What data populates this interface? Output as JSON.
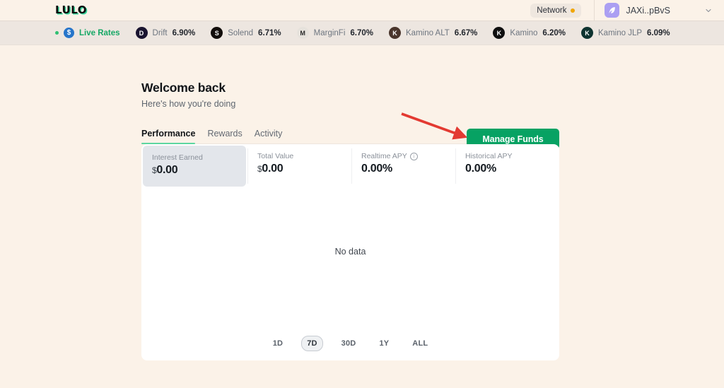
{
  "header": {
    "logo": "LULO",
    "network_label": "Network",
    "network_dot_color": "#F0A500",
    "wallet_name": "JAXi..pBvS"
  },
  "ticker": {
    "live_label": "Live Rates",
    "items": [
      {
        "name": "Drift",
        "rate": "6.90%",
        "icon_color": "#1A1430",
        "icon_char": "D"
      },
      {
        "name": "Solend",
        "rate": "6.71%",
        "icon_color": "#120D0A",
        "icon_char": "S"
      },
      {
        "name": "MarginFi",
        "rate": "6.70%",
        "icon_color": "#E6E2DC",
        "icon_char": "M"
      },
      {
        "name": "Kamino ALT",
        "rate": "6.67%",
        "icon_color": "#4A352C",
        "icon_char": "K"
      },
      {
        "name": "Kamino",
        "rate": "6.20%",
        "icon_color": "#0F0F0F",
        "icon_char": "K"
      },
      {
        "name": "Kamino JLP",
        "rate": "6.09%",
        "icon_color": "#0E3330",
        "icon_char": "K"
      }
    ]
  },
  "welcome": {
    "title": "Welcome back",
    "subtitle": "Here's how you're doing"
  },
  "actions": {
    "manage_funds_label": "Manage Funds",
    "manage_funds_color": "#07A263"
  },
  "tabs": [
    {
      "label": "Performance",
      "active": true
    },
    {
      "label": "Rewards",
      "active": false
    },
    {
      "label": "Activity",
      "active": false
    }
  ],
  "stats": [
    {
      "label": "Interest Earned",
      "currency": "$",
      "value": "0.00",
      "selected": true,
      "info": false
    },
    {
      "label": "Total Value",
      "currency": "$",
      "value": "0.00",
      "selected": false,
      "info": false
    },
    {
      "label": "Realtime APY",
      "currency": "",
      "value": "0.00%",
      "selected": false,
      "info": true
    },
    {
      "label": "Historical APY",
      "currency": "",
      "value": "0.00%",
      "selected": false,
      "info": false
    }
  ],
  "chart": {
    "empty_message": "No data"
  },
  "ranges": [
    {
      "label": "1D",
      "active": false
    },
    {
      "label": "7D",
      "active": true
    },
    {
      "label": "30D",
      "active": false
    },
    {
      "label": "1Y",
      "active": false
    },
    {
      "label": "ALL",
      "active": false
    }
  ]
}
